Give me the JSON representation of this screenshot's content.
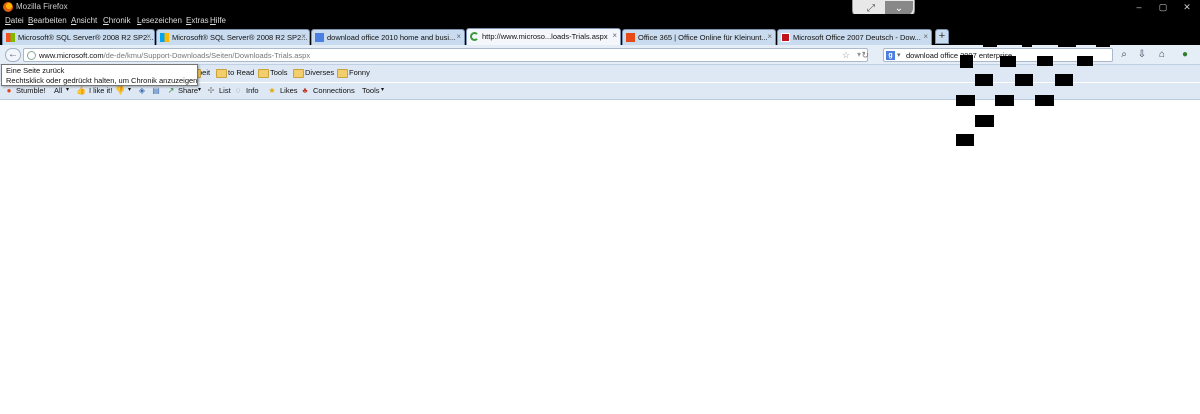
{
  "window": {
    "title": "Mozilla Firefox",
    "controls": [
      "–",
      "▢",
      "✕"
    ]
  },
  "menu": [
    "Datei",
    "Bearbeiten",
    "Ansicht",
    "Chronik",
    "Lesezeichen",
    "Extras",
    "Hilfe"
  ],
  "tabs": [
    {
      "label": "Microsoft® SQL Server® 2008 R2 SP2...",
      "favicon": "windows-icon",
      "close": "×",
      "active": false
    },
    {
      "label": "Microsoft® SQL Server® 2008 R2 SP2...",
      "favicon": "windows-icon",
      "close": "×",
      "active": false
    },
    {
      "label": "download office 2010 home and busi...",
      "favicon": "google-icon",
      "close": "×",
      "active": false
    },
    {
      "label": "http://www.microso...loads-Trials.aspx",
      "favicon": "loading-icon",
      "close": "×",
      "active": true
    },
    {
      "label": "Office 365 | Office Online für Kleinunt...",
      "favicon": "office-icon",
      "close": "×",
      "active": false
    },
    {
      "label": "Microsoft Office 2007 Deutsch - Dow...",
      "favicon": "chip-icon",
      "close": "×",
      "active": false
    }
  ],
  "new_tab": "+",
  "address": {
    "host": "www.microsoft.com",
    "path": "/de-de/kmu/Support-Downloads/Seiten/Downloads-Trials.aspx"
  },
  "search": {
    "engine_icon": "g",
    "text": "download office 2007 enterprise"
  },
  "bookmarks": [
    "beit",
    "to Read",
    "Tools",
    "Diverses",
    "Fonny"
  ],
  "stumble_toolbar": {
    "stumble": "Stumble!",
    "all": "All",
    "ilike": "I like it!",
    "share": "Share",
    "list": "List",
    "info": "Info",
    "likes": "Likes",
    "connections": "Connections",
    "tools": "Tools"
  },
  "tooltip": {
    "line1": "Eine Seite zurück",
    "line2": "Rechtsklick oder gedrückt halten, um Chronik anzuzeigen"
  },
  "colors": {
    "chrome_dark": "#000000",
    "toolbar": "#e5edf7",
    "tab": "#c9dbee",
    "tab_active": "#f3f6fa"
  }
}
